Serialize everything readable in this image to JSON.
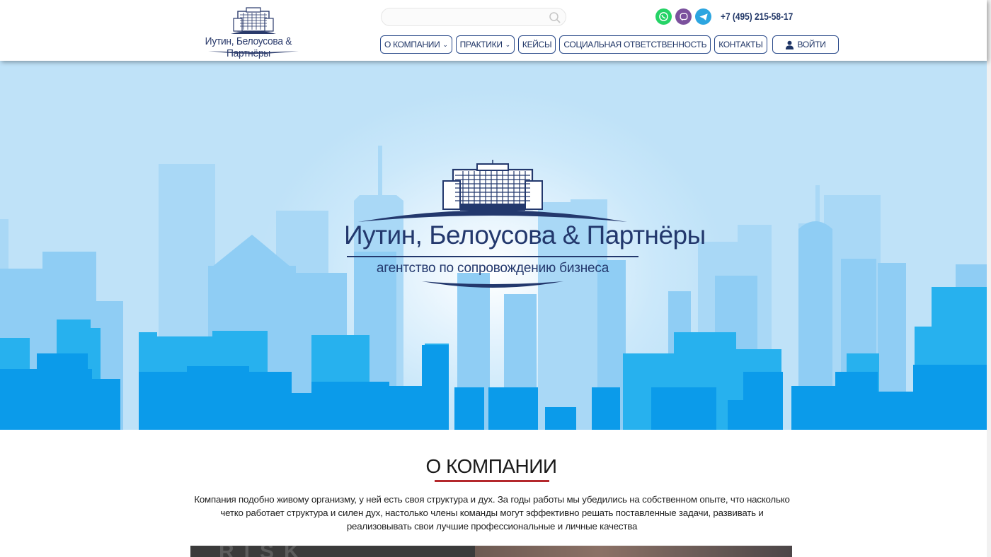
{
  "header": {
    "logo_text": "Иутин, Белоусова & Партнёры",
    "search_placeholder": "",
    "phone": "+7 (495) 215-58-17",
    "messengers": [
      "whatsapp-icon",
      "viber-icon",
      "telegram-icon"
    ],
    "nav": [
      {
        "label": "О КОМПАНИИ",
        "dropdown": true
      },
      {
        "label": "ПРАКТИКИ",
        "dropdown": true
      },
      {
        "label": "КЕЙСЫ",
        "dropdown": false
      },
      {
        "label": "СОЦИАЛЬНАЯ ОТВЕТСТВЕННОСТЬ",
        "dropdown": false
      },
      {
        "label": "КОНТАКТЫ",
        "dropdown": false
      }
    ],
    "login_label": "ВОЙТИ"
  },
  "hero": {
    "title": "Иутин, Белоусова & Партнёры",
    "tagline": "агентство по сопровождению бизнеса"
  },
  "about": {
    "title": "О КОМПАНИИ",
    "text": "Компания подобно живому организму, у ней есть своя структура и дух. За годы работы мы убедились на собственном опыте, что насколько четко работает структура и силен дух, настолько члены команды могут эффективно решать поставленные задачи, развивать и реализовывать свои лучшие профессиональные и личные качества",
    "video_letters": "RISK"
  },
  "colors": {
    "brand_navy": "#23386d",
    "accent_red": "#b4282c",
    "whatsapp": "#25d366",
    "viber": "#7b519d",
    "telegram": "#2ca5e0"
  }
}
